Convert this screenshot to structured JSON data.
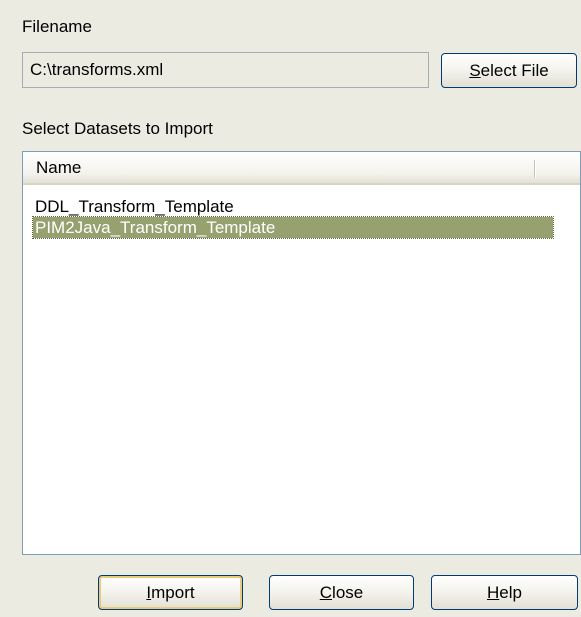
{
  "filename": {
    "label": "Filename",
    "value": "C:\\transforms.xml",
    "select_button": "elect File",
    "select_button_mnemonic": "S"
  },
  "datasets": {
    "label": "Select Datasets to Import",
    "column_name": "Name",
    "rows": [
      {
        "name": "DDL_Transform_Template",
        "selected": false
      },
      {
        "name": "PIM2Java_Transform_Template",
        "selected": true
      }
    ]
  },
  "buttons": {
    "import_mnemonic": "I",
    "import_rest": "mport",
    "close_mnemonic": "C",
    "close_rest": "lose",
    "help_mnemonic": "H",
    "help_rest": "elp"
  },
  "colors": {
    "dialog_bg": "#ecebe2",
    "selection_bg": "#97a06f",
    "button_border": "#003c74"
  }
}
